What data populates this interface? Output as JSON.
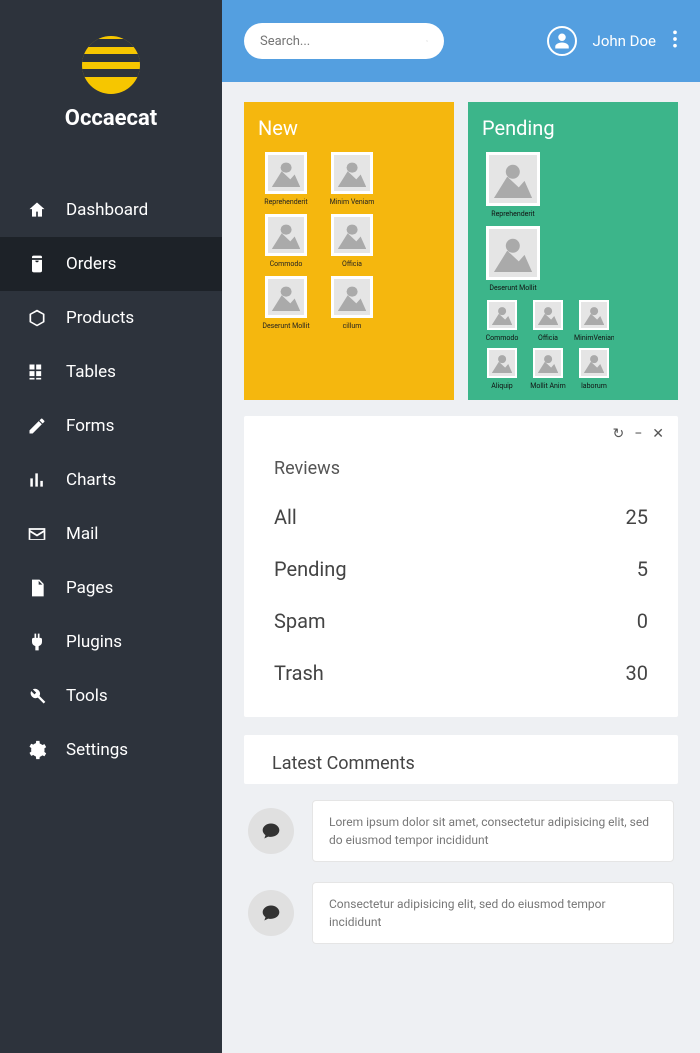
{
  "brand": "Occaecat",
  "search": {
    "placeholder": "Search..."
  },
  "user": {
    "name": "John Doe"
  },
  "nav": [
    {
      "key": "dashboard",
      "label": "Dashboard"
    },
    {
      "key": "orders",
      "label": "Orders",
      "active": true
    },
    {
      "key": "products",
      "label": "Products"
    },
    {
      "key": "tables",
      "label": "Tables"
    },
    {
      "key": "forms",
      "label": "Forms"
    },
    {
      "key": "charts",
      "label": "Charts"
    },
    {
      "key": "mail",
      "label": "Mail"
    },
    {
      "key": "pages",
      "label": "Pages"
    },
    {
      "key": "plugins",
      "label": "Plugins"
    },
    {
      "key": "tools",
      "label": "Tools"
    },
    {
      "key": "settings",
      "label": "Settings"
    }
  ],
  "cards": {
    "new": {
      "title": "New",
      "items": [
        "Reprehenderit",
        "Minim Veniam",
        "Commodo",
        "Officia",
        "Deserunt Mollit",
        "cillum"
      ]
    },
    "pending": {
      "title": "Pending",
      "large": [
        "Reprehenderit",
        "Deserunt Mollit"
      ],
      "small": [
        "Commodo",
        "Officia",
        "MinimVeniam",
        "Aliquip",
        "Mollit Anim",
        "laborum"
      ]
    }
  },
  "reviews": {
    "heading": "Reviews",
    "rows": [
      {
        "label": "All",
        "value": "25"
      },
      {
        "label": "Pending",
        "value": "5"
      },
      {
        "label": "Spam",
        "value": "0"
      },
      {
        "label": "Trash",
        "value": "30"
      }
    ]
  },
  "comments": {
    "heading": "Latest Comments",
    "items": [
      "Lorem ipsum dolor sit amet, consectetur adipisicing elit, sed do eiusmod tempor incididunt",
      "Consectetur adipisicing elit, sed do eiusmod tempor incididunt"
    ]
  }
}
